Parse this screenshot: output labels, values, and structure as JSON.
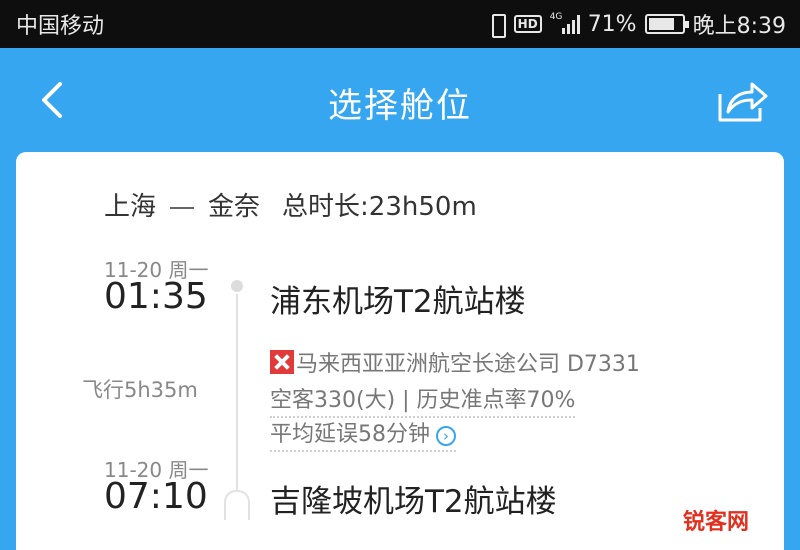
{
  "status_bar": {
    "carrier": "中国移动",
    "network": "4G",
    "battery": "71%",
    "time": "晚上8:39"
  },
  "nav": {
    "title": "选择舱位",
    "back_icon": "chevron-left-icon",
    "share_icon": "share-icon"
  },
  "route": {
    "origin": "上海",
    "destination": "金奈",
    "total_duration": "总时长:23h50m"
  },
  "segment": {
    "departure": {
      "date": "11-20 周一",
      "time": "01:35",
      "airport": "浦东机场T2航站楼"
    },
    "flight_duration": "飞行5h35m",
    "airline": "马来西亚亚洲航空长途公司 D7331",
    "aircraft_info": "空客330(大) | 历史准点率70%",
    "avg_delay": "平均延误58分钟",
    "arrival": {
      "date": "11-20 周一",
      "time": "07:10",
      "airport": "吉隆坡机场T2航站楼"
    }
  },
  "watermark": "锐客网",
  "colors": {
    "accent": "#37a6f0",
    "airline_logo": "#e03a3a",
    "watermark": "#e1301e"
  }
}
